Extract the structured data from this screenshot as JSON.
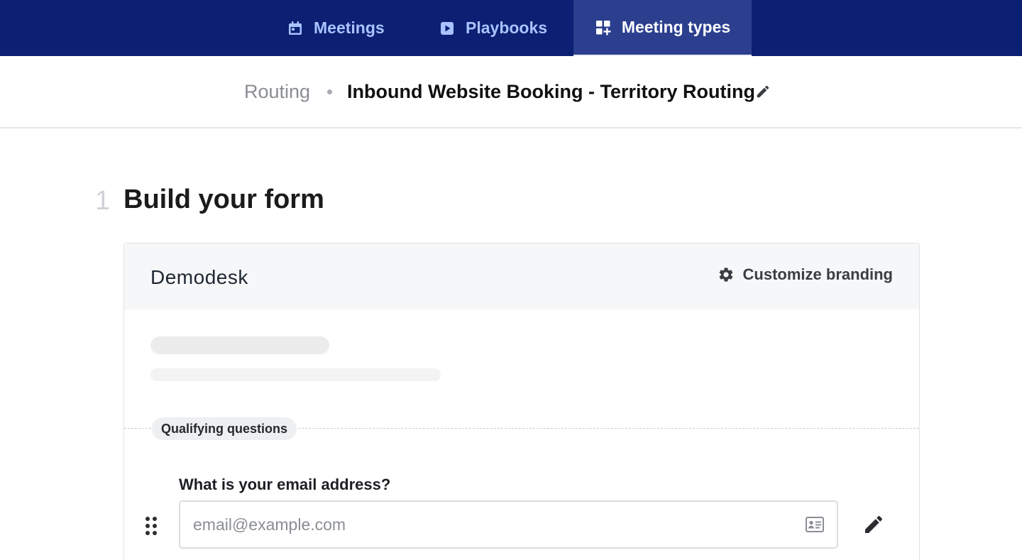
{
  "nav": {
    "tabs": [
      {
        "label": "Meetings",
        "icon": "calendar-icon"
      },
      {
        "label": "Playbooks",
        "icon": "play-icon"
      },
      {
        "label": "Meeting types",
        "icon": "dashboard-add-icon",
        "active": true
      }
    ]
  },
  "breadcrumb": {
    "parent": "Routing",
    "title": "Inbound Website Booking - Territory Routing",
    "edit_icon": "pencil-icon"
  },
  "section": {
    "step": "1",
    "title": "Build your form"
  },
  "form_card": {
    "brand_logo": "Demodesk",
    "customize_label": "Customize branding",
    "customize_icon": "gear-icon",
    "section_badge": "Qualifying questions",
    "question": {
      "label": "What is your email address?",
      "placeholder": "email@example.com",
      "value": "",
      "field_icon": "contact-card-icon",
      "edit_icon": "pencil-icon",
      "drag_icon": "drag-handle-icon"
    }
  },
  "colors": {
    "nav_background": "#0b1f73",
    "nav_active": "#2b3f8e",
    "nav_text": "#a9c3ff"
  }
}
